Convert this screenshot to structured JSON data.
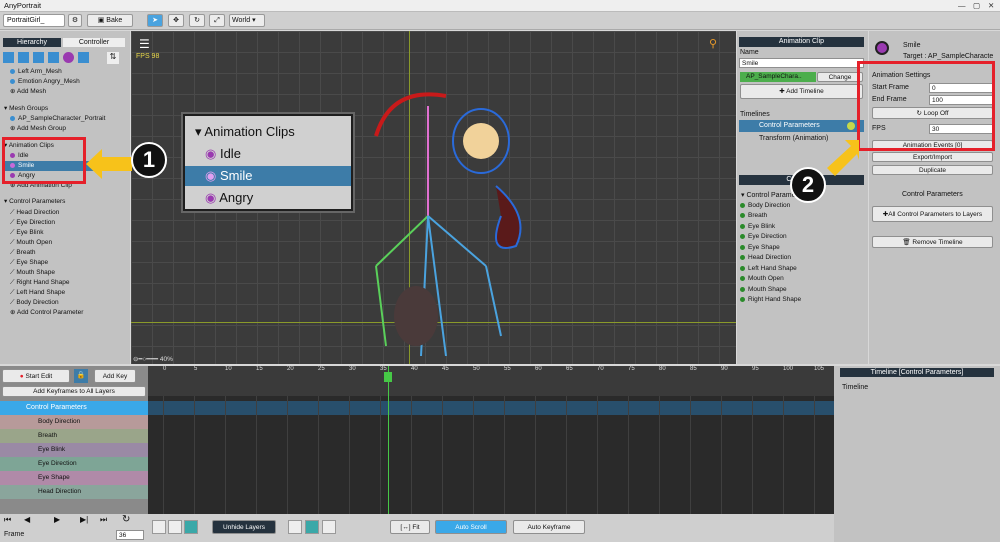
{
  "app": {
    "title": "AnyPortrait"
  },
  "toolbar": {
    "portrait": "PortraitGirl_",
    "bake": "Bake",
    "world": "World"
  },
  "hierarchy": {
    "tab1": "Hierarchy",
    "tab2": "Controller",
    "items_top": [
      "Left Arm_Mesh",
      "Emotion Angry_Mesh",
      "Add Mesh"
    ],
    "mesh_groups": "Mesh Groups",
    "mesh_group_items": [
      "AP_SampleCharacter_Portrait",
      "Add Mesh Group"
    ],
    "anim_clips": "Animation Clips",
    "clip_items": [
      "Idle",
      "Smile",
      "Angry"
    ],
    "add_clip": "Add Animation Clip",
    "control_params": "Control Parameters",
    "param_items": [
      "Head Direction",
      "Eye Direction",
      "Eye Blink",
      "Mouth Open",
      "Breath",
      "Eye Shape",
      "Mouth Shape",
      "Right Hand Shape",
      "Left Hand Shape",
      "Body Direction",
      "Add Control Parameter"
    ]
  },
  "viewport": {
    "fps": "FPS 98",
    "zoom": "40%"
  },
  "popup": {
    "title": "Animation Clips",
    "items": [
      "Idle",
      "Smile",
      "Angry"
    ]
  },
  "clip_panel": {
    "header": "Animation Clip",
    "name_label": "Name",
    "name_value": "Smile",
    "target_value": "AP_SampleChara..",
    "change": "Change",
    "add_timeline": "Add Timeline",
    "timelines_label": "Timelines",
    "timelines": [
      "Control Parameters",
      "Transform (Animation)"
    ],
    "controller_header": "Controller",
    "ctrl_group": "Control Parameters",
    "ctrl_items": [
      "Body Direction",
      "Breath",
      "Eye Blink",
      "Eye Direction",
      "Eye Shape",
      "Head Direction",
      "Left Hand Shape",
      "Mouth Open",
      "Mouth Shape",
      "Right Hand Shape"
    ]
  },
  "right": {
    "title": "Smile",
    "target": "Target : AP_SampleCharacte",
    "settings": "Animation Settings",
    "start_label": "Start Frame",
    "start_value": "0",
    "end_label": "End Frame",
    "end_value": "100",
    "loop": "Loop Off",
    "fps_label": "FPS",
    "fps_value": "30",
    "events": "Animation Events [0]",
    "export": "Export/Import",
    "duplicate": "Duplicate",
    "cp_label": "Control Parameters",
    "all_cp": "All Control Parameters to Layers",
    "remove": "Remove Timeline"
  },
  "timeline": {
    "start_edit": "Start Edit",
    "add_key": "Add Key",
    "add_all": "Add Keyframes to All Layers",
    "root": "Control Parameters",
    "rows": [
      "Body Direction",
      "Breath",
      "Eye Blink",
      "Eye Direction",
      "Eye Shape",
      "Head Direction"
    ],
    "frame_label": "Frame",
    "frame_value": "36",
    "ruler": [
      "0",
      "5",
      "10",
      "15",
      "20",
      "25",
      "30",
      "35",
      "40",
      "45",
      "50",
      "55",
      "60",
      "65",
      "70",
      "75",
      "80",
      "85",
      "90",
      "95",
      "100",
      "105"
    ],
    "info_header": "Timeline [Control Parameters]",
    "info_label": "Timeline",
    "unhide": "Unhide Layers",
    "fit": "Fit",
    "auto_scroll": "Auto Scroll",
    "auto_key": "Auto Keyframe"
  },
  "callouts": [
    "1",
    "2"
  ],
  "colors": {
    "accent": "#4aa3df",
    "highlight": "#e5202a",
    "arrow": "#f7c21a",
    "selected": "#3d7ca8"
  }
}
